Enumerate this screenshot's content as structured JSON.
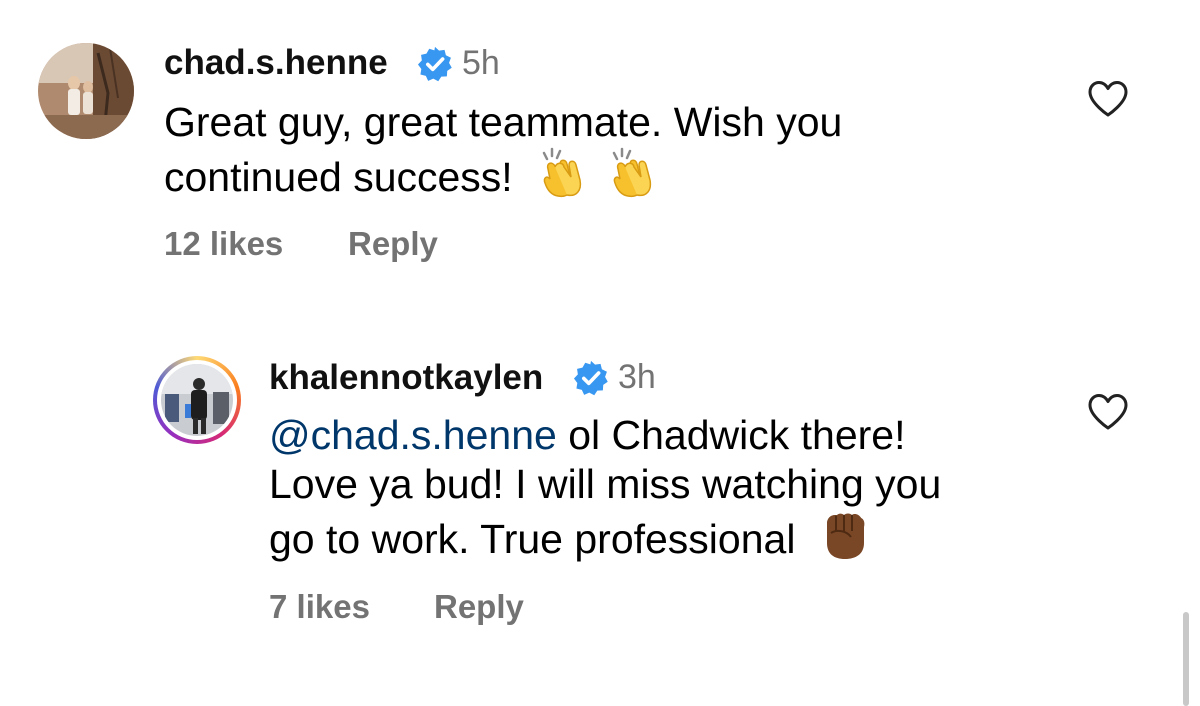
{
  "comments": [
    {
      "username": "chad.s.henne",
      "time": "5h",
      "text_line1": "Great guy, great teammate. Wish you",
      "text_line2": "continued success!",
      "emojis": [
        "clapping-hands",
        "clapping-hands"
      ],
      "likes": "12 likes",
      "reply": "Reply"
    },
    {
      "username": "khalennotkaylen",
      "time": "3h",
      "mention": "@chad.s.henne",
      "text_line1_rest": " ol Chadwick there!",
      "text_line2": "Love ya bud! I will miss watching you",
      "text_line3": "go to work. True professional",
      "emojis": [
        "raised-fist-dark-skin"
      ],
      "likes": "7 likes",
      "reply": "Reply"
    }
  ],
  "colors": {
    "secondary_text": "#737373",
    "mention": "#00376b",
    "verified": "#3897f0"
  }
}
